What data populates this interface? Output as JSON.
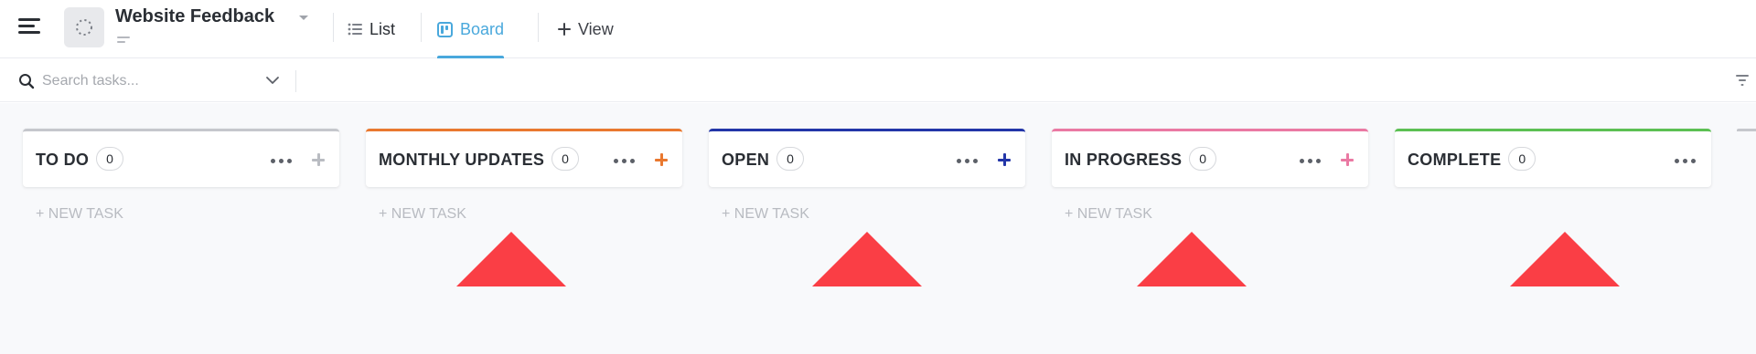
{
  "header": {
    "title": "Website Feedback",
    "tabs": [
      {
        "label": "List",
        "icon": "list-icon",
        "active": false
      },
      {
        "label": "Board",
        "icon": "board-icon",
        "active": true,
        "color": "#49a8dc"
      },
      {
        "label": "View",
        "icon": "plus-icon",
        "active": false
      }
    ]
  },
  "search": {
    "placeholder": "Search tasks...",
    "value": ""
  },
  "board": {
    "new_task_label": "+ NEW TASK",
    "columns": [
      {
        "name": "TO DO",
        "count": "0",
        "color": "#c5c7cc",
        "add_color": "#b9bcc2",
        "show_new_task": true
      },
      {
        "name": "MONTHLY UPDATES",
        "count": "0",
        "color": "#e9782f",
        "add_color": "#e9782f",
        "show_new_task": true
      },
      {
        "name": "OPEN",
        "count": "0",
        "color": "#2336a8",
        "add_color": "#2336a8",
        "show_new_task": true
      },
      {
        "name": "IN PROGRESS",
        "count": "0",
        "color": "#ea79a3",
        "add_color": "#ea79a3",
        "show_new_task": true
      },
      {
        "name": "COMPLETE",
        "count": "0",
        "color": "#5cc053",
        "add_color": null,
        "show_new_task": false
      }
    ]
  },
  "annotation_color": "#fa3e45"
}
